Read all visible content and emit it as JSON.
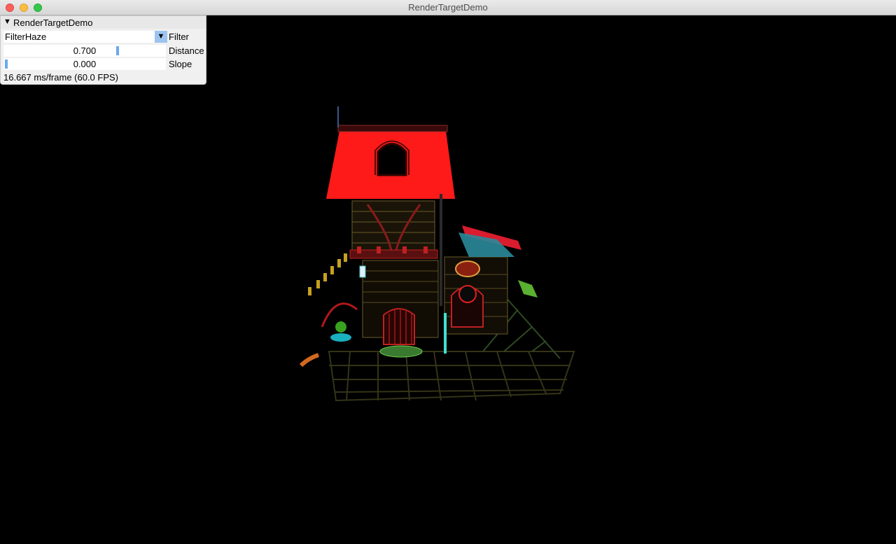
{
  "window": {
    "title": "RenderTargetDemo"
  },
  "panel": {
    "title": "RenderTargetDemo",
    "collapse_icon": "triangle-down-icon",
    "filter": {
      "value": "FilterHaze",
      "label": "Filter",
      "dropdown_icon": "triangle-down-icon"
    },
    "distance": {
      "value_text": "0.700",
      "value": 0.7,
      "label": "Distance"
    },
    "slope": {
      "value_text": "0.000",
      "value": 0.0,
      "label": "Slope"
    },
    "fps_text": "16.667 ms/frame (60.0 FPS)"
  },
  "colors": {
    "roof": "#ff1a1a",
    "slider_grab": "#6aa8f0",
    "combo_button": "#9dc4ef",
    "background": "#000000"
  }
}
